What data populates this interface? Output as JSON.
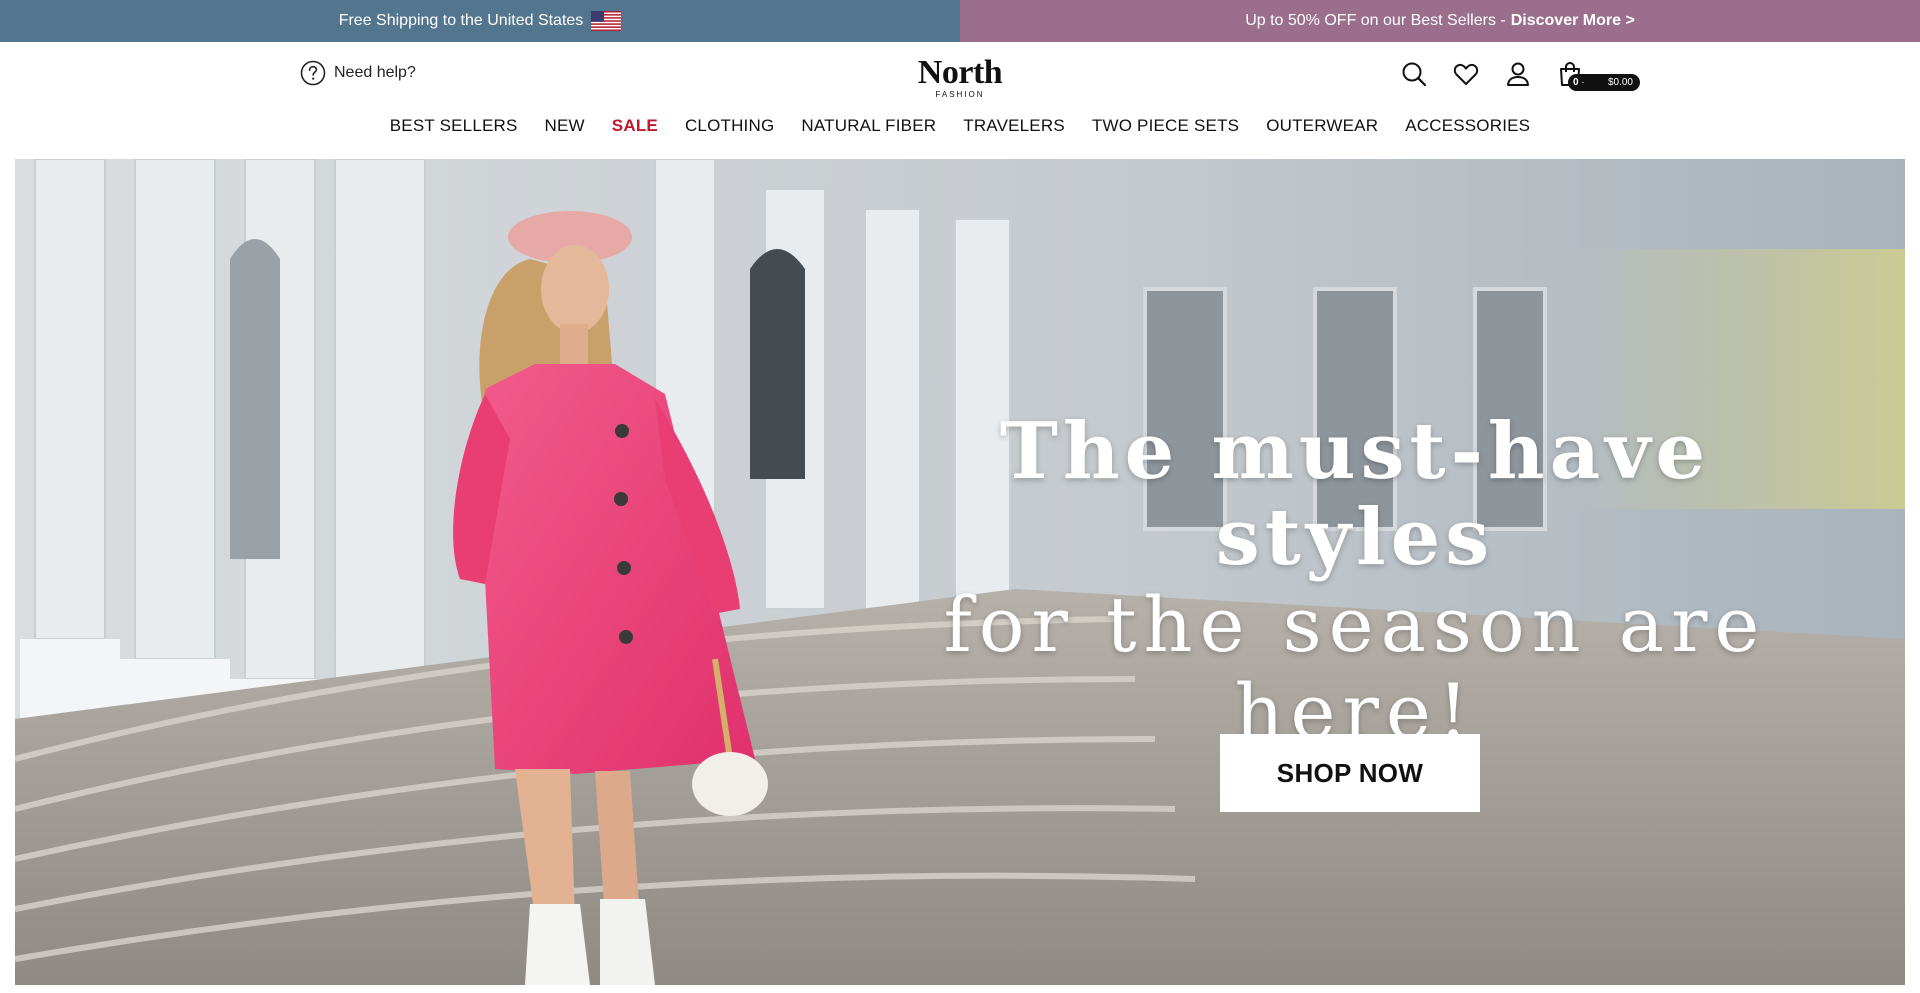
{
  "announcement": {
    "left_text": "Free Shipping to the United States",
    "right_text": "Up to 50% OFF on our Best Sellers -",
    "right_link": "Discover More >",
    "left_color": "#53758d",
    "right_color": "#9b6f8c",
    "flag_icon": "us-flag-icon"
  },
  "header": {
    "help_label": "Need help?",
    "help_icon": "question-circle-icon",
    "logo_main": "North",
    "logo_sub": "FASHION",
    "icons": [
      "search-icon",
      "heart-icon",
      "user-icon",
      "bag-icon"
    ],
    "cart_count": "0",
    "cart_sep": "·",
    "cart_total": "$0.00"
  },
  "nav": {
    "items": [
      {
        "label": "BEST SELLERS"
      },
      {
        "label": "NEW"
      },
      {
        "label": "SALE",
        "highlight": "#c0182e"
      },
      {
        "label": "CLOTHING"
      },
      {
        "label": "NATURAL FIBER"
      },
      {
        "label": "TRAVELERS"
      },
      {
        "label": "TWO PIECE SETS"
      },
      {
        "label": "OUTERWEAR"
      },
      {
        "label": "ACCESSORIES"
      }
    ]
  },
  "hero": {
    "headline_line1": "The must-have styles",
    "headline_line2": "for the season are here!",
    "cta_label": "SHOP NOW",
    "coat_color": "#ee3f78"
  }
}
